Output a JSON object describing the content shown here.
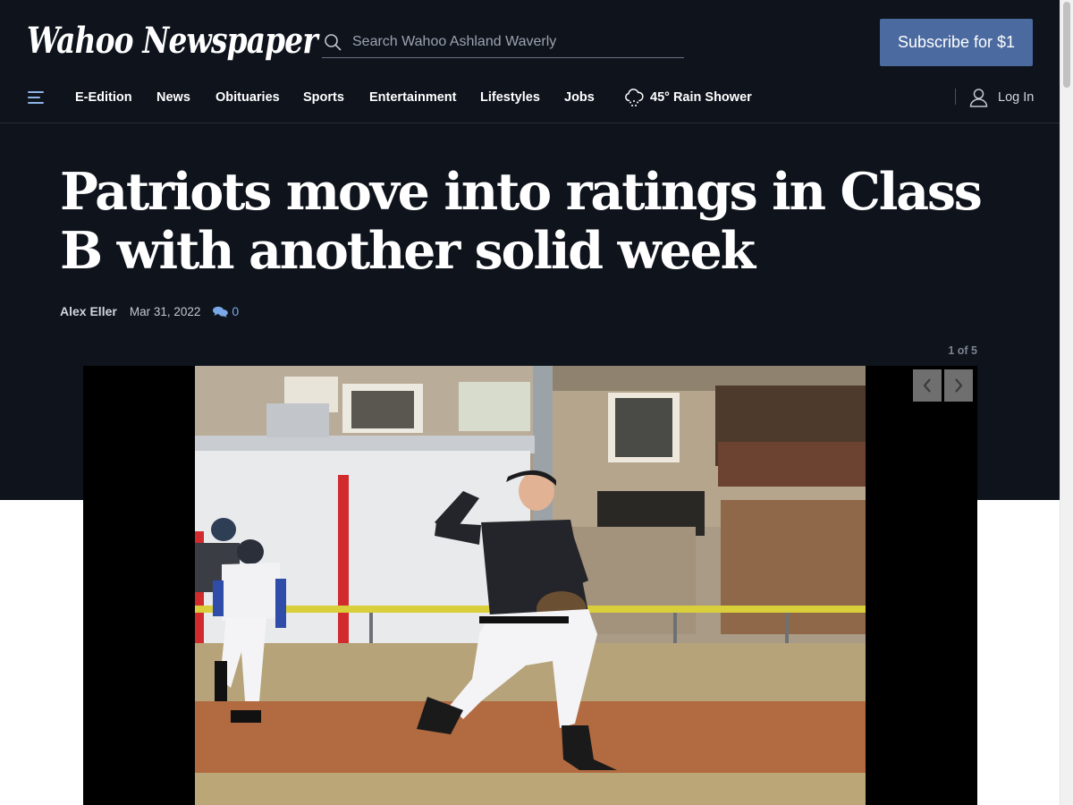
{
  "header": {
    "logo_text": "Wahoo Newspaper",
    "search_placeholder": "Search Wahoo Ashland Waverly",
    "subscribe_label": "Subscribe for $1"
  },
  "nav": {
    "items": [
      "E-Edition",
      "News",
      "Obituaries",
      "Sports",
      "Entertainment",
      "Lifestyles",
      "Jobs"
    ],
    "weather": "45° Rain Shower",
    "login_label": "Log In"
  },
  "article": {
    "headline": "Patriots move into ratings in Class B with another solid week",
    "author": "Alex Eller",
    "date": "Mar 31, 2022",
    "comment_count": "0"
  },
  "gallery": {
    "counter": "1 of 5",
    "photo_caption_alt": "Patriots pitcher delivering a pitch"
  },
  "colors": {
    "background_dark": "#0e131c",
    "accent_blue": "#4b6aa0",
    "link_blue": "#7aa7e6"
  }
}
